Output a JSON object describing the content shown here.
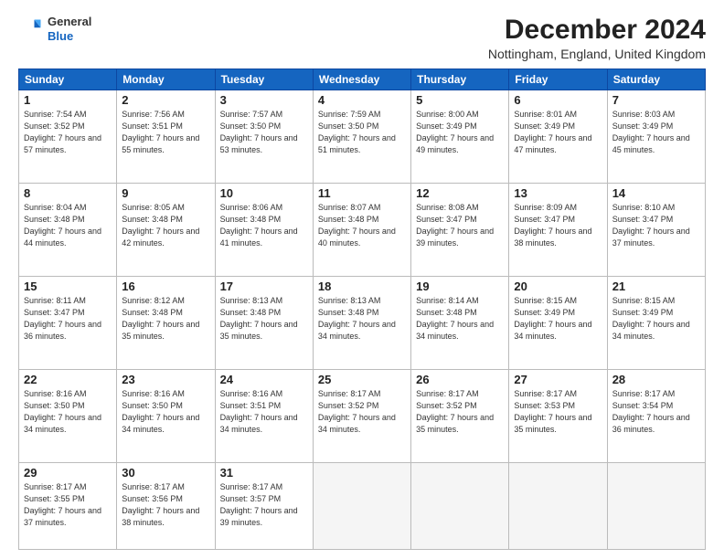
{
  "header": {
    "logo_line1": "General",
    "logo_line2": "Blue",
    "month_year": "December 2024",
    "location": "Nottingham, England, United Kingdom"
  },
  "weekdays": [
    "Sunday",
    "Monday",
    "Tuesday",
    "Wednesday",
    "Thursday",
    "Friday",
    "Saturday"
  ],
  "weeks": [
    [
      {
        "day": "1",
        "sunrise": "7:54 AM",
        "sunset": "3:52 PM",
        "daylight": "7 hours and 57 minutes."
      },
      {
        "day": "2",
        "sunrise": "7:56 AM",
        "sunset": "3:51 PM",
        "daylight": "7 hours and 55 minutes."
      },
      {
        "day": "3",
        "sunrise": "7:57 AM",
        "sunset": "3:50 PM",
        "daylight": "7 hours and 53 minutes."
      },
      {
        "day": "4",
        "sunrise": "7:59 AM",
        "sunset": "3:50 PM",
        "daylight": "7 hours and 51 minutes."
      },
      {
        "day": "5",
        "sunrise": "8:00 AM",
        "sunset": "3:49 PM",
        "daylight": "7 hours and 49 minutes."
      },
      {
        "day": "6",
        "sunrise": "8:01 AM",
        "sunset": "3:49 PM",
        "daylight": "7 hours and 47 minutes."
      },
      {
        "day": "7",
        "sunrise": "8:03 AM",
        "sunset": "3:49 PM",
        "daylight": "7 hours and 45 minutes."
      }
    ],
    [
      {
        "day": "8",
        "sunrise": "8:04 AM",
        "sunset": "3:48 PM",
        "daylight": "7 hours and 44 minutes."
      },
      {
        "day": "9",
        "sunrise": "8:05 AM",
        "sunset": "3:48 PM",
        "daylight": "7 hours and 42 minutes."
      },
      {
        "day": "10",
        "sunrise": "8:06 AM",
        "sunset": "3:48 PM",
        "daylight": "7 hours and 41 minutes."
      },
      {
        "day": "11",
        "sunrise": "8:07 AM",
        "sunset": "3:48 PM",
        "daylight": "7 hours and 40 minutes."
      },
      {
        "day": "12",
        "sunrise": "8:08 AM",
        "sunset": "3:47 PM",
        "daylight": "7 hours and 39 minutes."
      },
      {
        "day": "13",
        "sunrise": "8:09 AM",
        "sunset": "3:47 PM",
        "daylight": "7 hours and 38 minutes."
      },
      {
        "day": "14",
        "sunrise": "8:10 AM",
        "sunset": "3:47 PM",
        "daylight": "7 hours and 37 minutes."
      }
    ],
    [
      {
        "day": "15",
        "sunrise": "8:11 AM",
        "sunset": "3:47 PM",
        "daylight": "7 hours and 36 minutes."
      },
      {
        "day": "16",
        "sunrise": "8:12 AM",
        "sunset": "3:48 PM",
        "daylight": "7 hours and 35 minutes."
      },
      {
        "day": "17",
        "sunrise": "8:13 AM",
        "sunset": "3:48 PM",
        "daylight": "7 hours and 35 minutes."
      },
      {
        "day": "18",
        "sunrise": "8:13 AM",
        "sunset": "3:48 PM",
        "daylight": "7 hours and 34 minutes."
      },
      {
        "day": "19",
        "sunrise": "8:14 AM",
        "sunset": "3:48 PM",
        "daylight": "7 hours and 34 minutes."
      },
      {
        "day": "20",
        "sunrise": "8:15 AM",
        "sunset": "3:49 PM",
        "daylight": "7 hours and 34 minutes."
      },
      {
        "day": "21",
        "sunrise": "8:15 AM",
        "sunset": "3:49 PM",
        "daylight": "7 hours and 34 minutes."
      }
    ],
    [
      {
        "day": "22",
        "sunrise": "8:16 AM",
        "sunset": "3:50 PM",
        "daylight": "7 hours and 34 minutes."
      },
      {
        "day": "23",
        "sunrise": "8:16 AM",
        "sunset": "3:50 PM",
        "daylight": "7 hours and 34 minutes."
      },
      {
        "day": "24",
        "sunrise": "8:16 AM",
        "sunset": "3:51 PM",
        "daylight": "7 hours and 34 minutes."
      },
      {
        "day": "25",
        "sunrise": "8:17 AM",
        "sunset": "3:52 PM",
        "daylight": "7 hours and 34 minutes."
      },
      {
        "day": "26",
        "sunrise": "8:17 AM",
        "sunset": "3:52 PM",
        "daylight": "7 hours and 35 minutes."
      },
      {
        "day": "27",
        "sunrise": "8:17 AM",
        "sunset": "3:53 PM",
        "daylight": "7 hours and 35 minutes."
      },
      {
        "day": "28",
        "sunrise": "8:17 AM",
        "sunset": "3:54 PM",
        "daylight": "7 hours and 36 minutes."
      }
    ],
    [
      {
        "day": "29",
        "sunrise": "8:17 AM",
        "sunset": "3:55 PM",
        "daylight": "7 hours and 37 minutes."
      },
      {
        "day": "30",
        "sunrise": "8:17 AM",
        "sunset": "3:56 PM",
        "daylight": "7 hours and 38 minutes."
      },
      {
        "day": "31",
        "sunrise": "8:17 AM",
        "sunset": "3:57 PM",
        "daylight": "7 hours and 39 minutes."
      },
      null,
      null,
      null,
      null
    ]
  ]
}
